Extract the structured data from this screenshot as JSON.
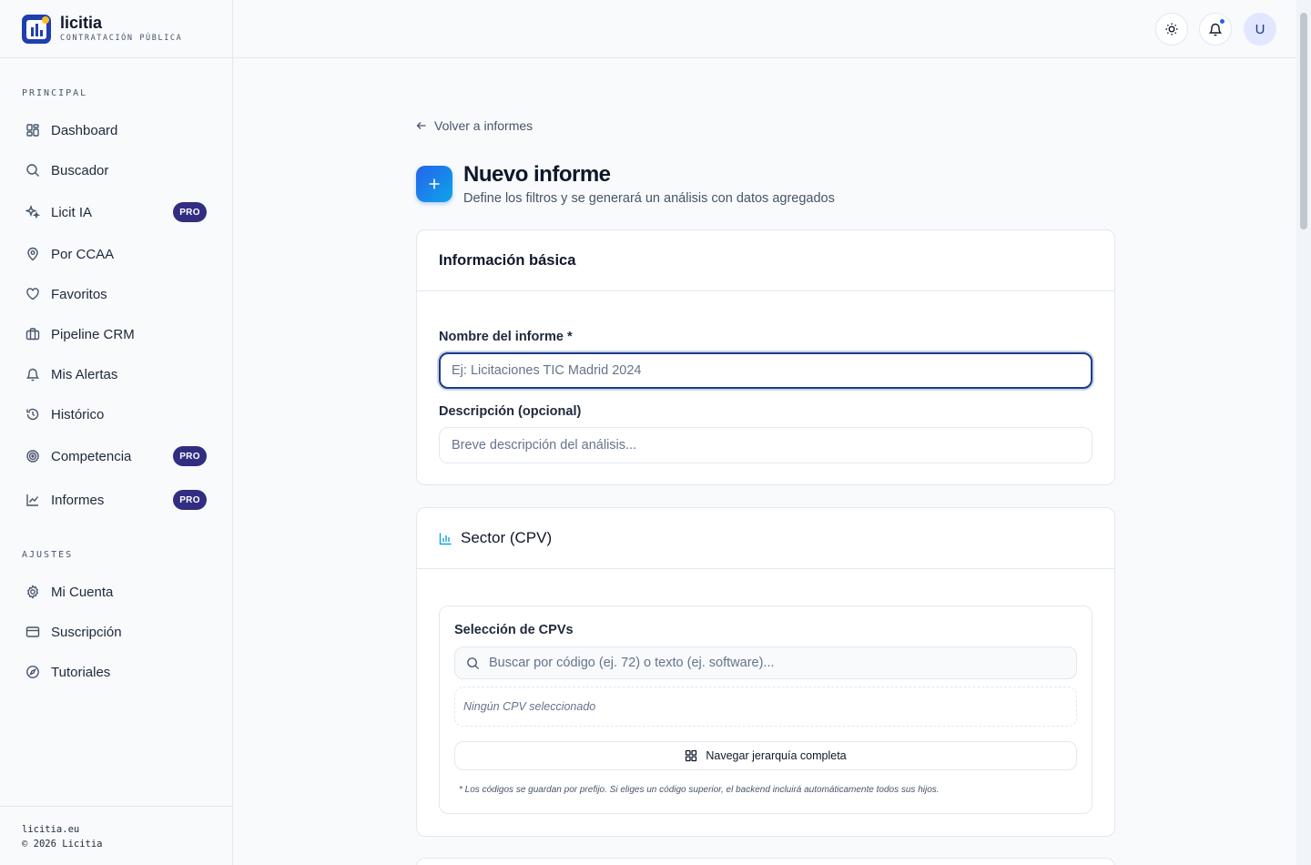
{
  "brand": {
    "name": "licitia",
    "subtitle": "CONTRATACIÓN PÚBLICA"
  },
  "sidebar": {
    "sections": {
      "main": "PRINCIPAL",
      "settings": "AJUSTES"
    },
    "items": [
      {
        "label": "Dashboard",
        "icon": "dashboard-icon"
      },
      {
        "label": "Buscador",
        "icon": "search-icon"
      },
      {
        "label": "Licit IA",
        "icon": "sparkles-icon",
        "badge": "PRO"
      },
      {
        "label": "Por CCAA",
        "icon": "map-pin-icon"
      },
      {
        "label": "Favoritos",
        "icon": "heart-icon"
      },
      {
        "label": "Pipeline CRM",
        "icon": "briefcase-icon"
      },
      {
        "label": "Mis Alertas",
        "icon": "bell-icon"
      },
      {
        "label": "Histórico",
        "icon": "history-icon"
      },
      {
        "label": "Competencia",
        "icon": "target-icon",
        "badge": "PRO"
      },
      {
        "label": "Informes",
        "icon": "chart-line-icon",
        "badge": "PRO"
      }
    ],
    "settings_items": [
      {
        "label": "Mi Cuenta",
        "icon": "gear-icon"
      },
      {
        "label": "Suscripción",
        "icon": "credit-card-icon"
      },
      {
        "label": "Tutoriales",
        "icon": "compass-icon"
      }
    ],
    "footer": {
      "site": "licitia.eu",
      "copyright": "© 2026 Licitia"
    }
  },
  "header": {
    "avatar_initial": "U"
  },
  "main": {
    "back_label": "Volver a informes",
    "title": "Nuevo informe",
    "subtitle": "Define los filtros y se generará un análisis con datos agregados",
    "basic": {
      "heading": "Información básica",
      "name_label": "Nombre del informe *",
      "name_placeholder": "Ej: Licitaciones TIC Madrid 2024",
      "name_value": "",
      "desc_label": "Descripción (opcional)",
      "desc_placeholder": "Breve descripción del análisis...",
      "desc_value": ""
    },
    "sector": {
      "heading": "Sector (CPV)",
      "selection_label": "Selección de CPVs",
      "search_placeholder": "Buscar por código (ej. 72) o texto (ej. software)...",
      "empty_text": "Ningún CPV seleccionado",
      "browse_label": "Navegar jerarquía completa",
      "note": "* Los códigos se guardan por prefijo. Si eliges un código superior, el backend incluirá automáticamente todos sus hijos."
    }
  },
  "colors": {
    "accent": "#1e3a8a",
    "pro_badge": "#312e81",
    "notification": "#2563eb"
  }
}
